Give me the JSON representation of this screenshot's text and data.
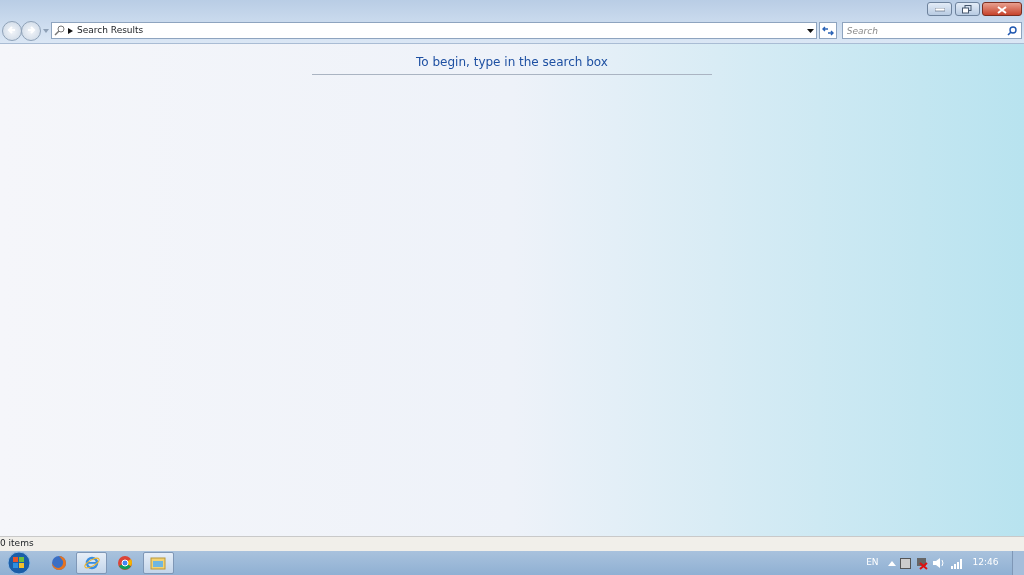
{
  "address_bar": {
    "path": "Search Results"
  },
  "search": {
    "placeholder": "Search"
  },
  "message": "To begin, type in the search box",
  "status_bar": {
    "text": "0 items"
  },
  "taskbar": {
    "apps": [
      {
        "kind": "firefox",
        "open": false
      },
      {
        "kind": "ie",
        "open": true
      },
      {
        "kind": "chrome",
        "open": false
      },
      {
        "kind": "explorer",
        "open": true
      }
    ],
    "language": "EN",
    "clock": "12:46"
  }
}
